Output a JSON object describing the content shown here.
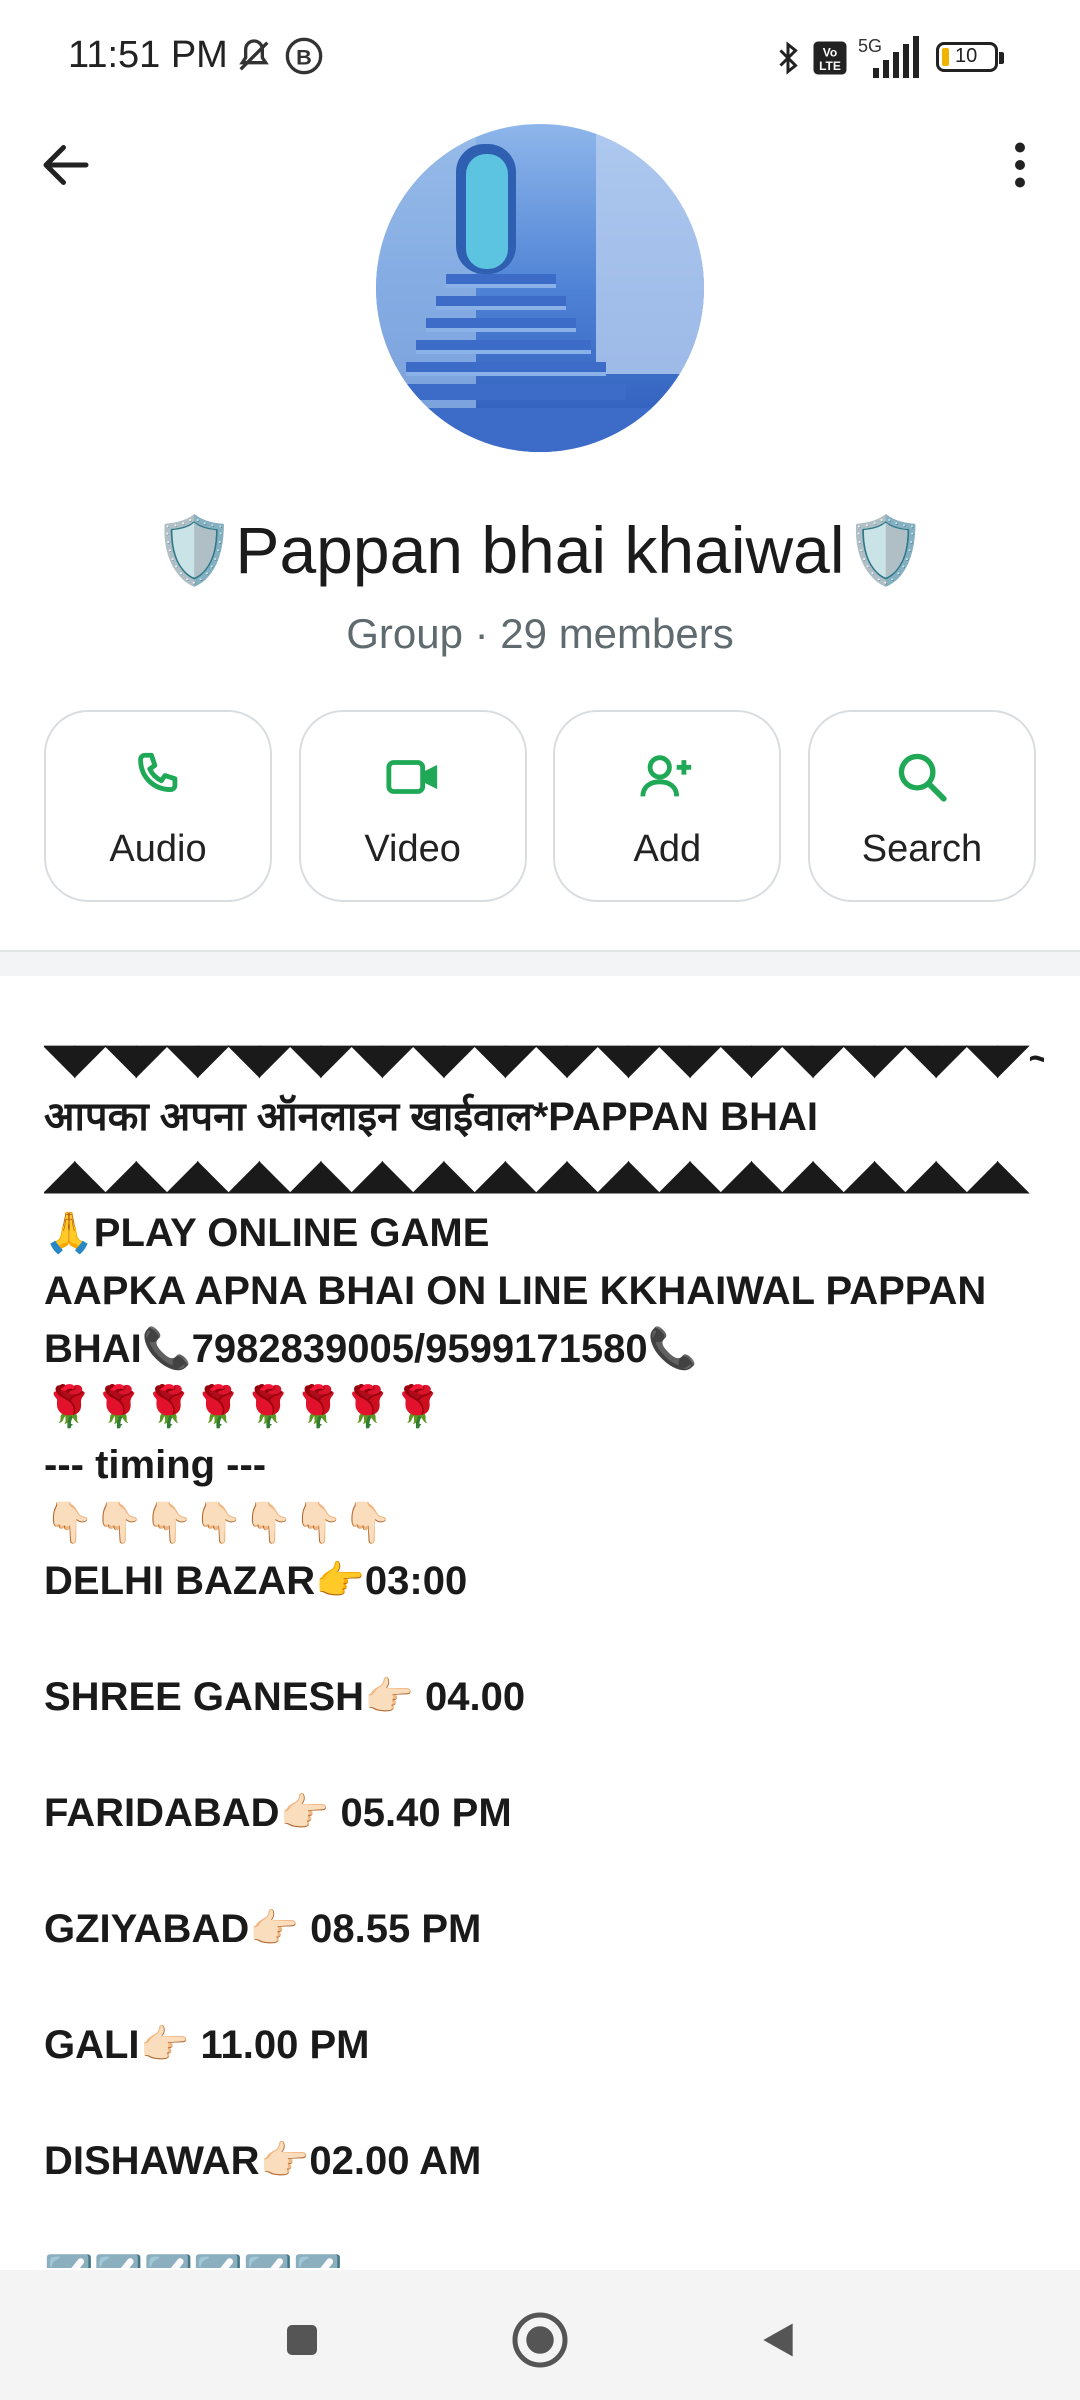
{
  "status_bar": {
    "time": "11:51 PM",
    "icons": [
      "mute-icon",
      "b-icon",
      "bluetooth-icon",
      "volte-icon",
      "signal-icon",
      "battery-icon"
    ],
    "network": "5G",
    "battery": "10"
  },
  "header": {
    "back_icon": "arrow-left-icon",
    "menu_icon": "more-vertical-icon"
  },
  "profile": {
    "name": "🛡️Pappan bhai khaiwal🛡️",
    "subtitle": "Group · 29 members"
  },
  "actions": [
    {
      "label": "Audio",
      "icon": "phone-icon"
    },
    {
      "label": "Video",
      "icon": "video-icon"
    },
    {
      "label": "Add",
      "icon": "add-person-icon"
    },
    {
      "label": "Search",
      "icon": "search-icon"
    }
  ],
  "accent_color": "#1fa855",
  "description": "◥◤◥◤◥◤◥◤◥◤◥◤◥◤◥◤◥◤◥◤◥◤◥◤◥◤◥◤◥◤◥◤~*\nआपका अपना ऑनलाइन खाईवाल*PAPPAN BHAI\n◢◣◢◣◢◣◢◣◢◣◢◣◢◣◢◣◢◣◢◣◢◣◢◣◢◣◢◣◢◣◢◣\n🙏PLAY ONLINE GAME\nAAPKA APNA BHAI ON LINE KKHAIWAL PAPPAN BHAI📞7982839005/9599171580📞\n🌹🌹🌹🌹🌹🌹🌹🌹\n      ---  timing ---\n👇🏻👇🏻👇🏻👇🏻👇🏻👇🏻👇🏻\nDELHI BAZAR👉03:00\n\nSHREE GANESH👉🏻 04.00\n\nFARIDABAD👉🏻 05.40 PM\n\nGZIYABAD👉🏻 08.55 PM\n\nGALI👉🏻 11.00 PM\n\nDISHAWAR👉🏻02.00 AM\n\n☑️☑️☑️☑️☑️☑️",
  "nav": {
    "icons": [
      "recent-apps-icon",
      "home-icon",
      "back-icon"
    ]
  }
}
